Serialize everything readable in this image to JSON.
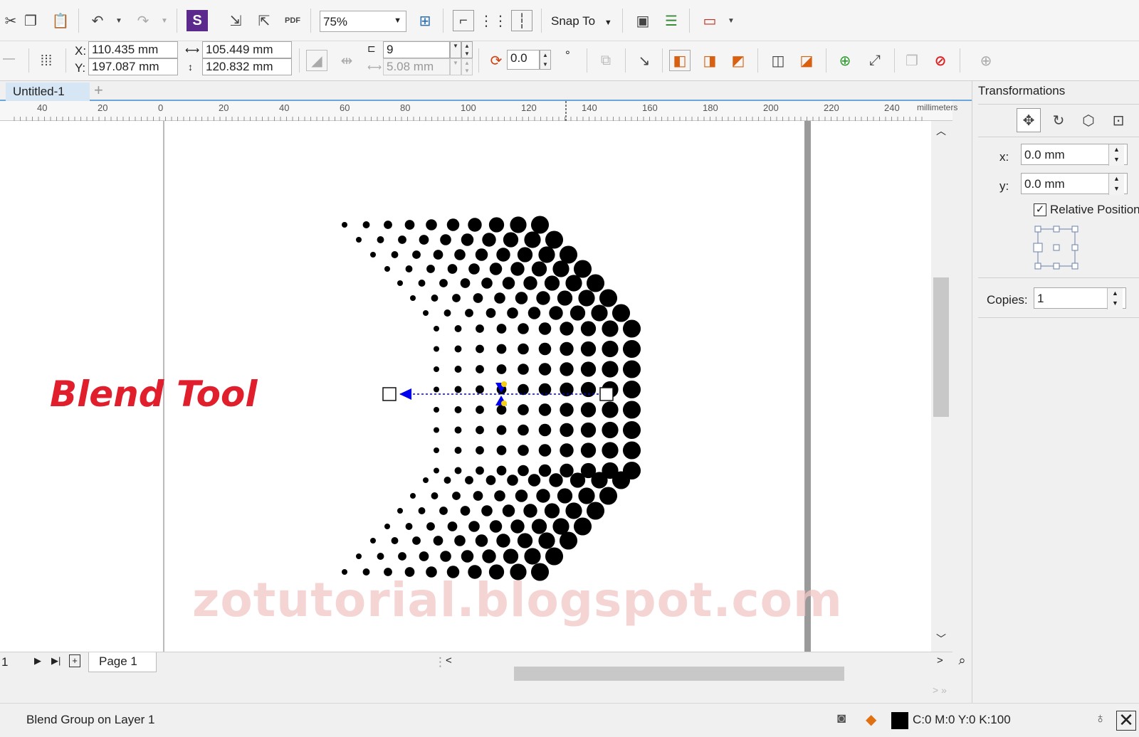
{
  "toolbar": {
    "zoom_value": "75%",
    "snap_label": "Snap To"
  },
  "property_bar": {
    "x_label": "X:",
    "x_value": "110.435 mm",
    "y_label": "Y:",
    "y_value": "197.087 mm",
    "width_value": "105.449 mm",
    "height_value": "120.832 mm",
    "steps_value": "9",
    "offset_value": "5.08 mm",
    "angle_value": "0.0",
    "angle_unit": "°"
  },
  "tabs": {
    "document_tab": "Untitled-1",
    "add_tab": "+"
  },
  "ruler": {
    "labels": [
      "40",
      "20",
      "0",
      "20",
      "40",
      "60",
      "80",
      "100",
      "120",
      "140",
      "160",
      "180",
      "200",
      "220",
      "240"
    ],
    "unit": "millimeters"
  },
  "docker": {
    "title": "Transformations",
    "x_label": "x:",
    "x_value": "0.0 mm",
    "y_label": "y:",
    "y_value": "0.0 mm",
    "relative_label": "Relative Position",
    "relative_checked": true,
    "copies_label": "Copies:",
    "copies_value": "1"
  },
  "page_nav": {
    "page_count": "1",
    "page_tab": "Page 1"
  },
  "status": {
    "object_info": "Blend Group on Layer 1",
    "fill_info": "C:0 M:0 Y:0 K:100"
  },
  "overlay": {
    "title": "Blend Tool",
    "watermark": "zotutorial.blogspot.com"
  },
  "colors": {
    "accent_red": "#e01e2c",
    "blend_blue": "#0000ee",
    "dot_black": "#000000",
    "watermark_pink": "#f2c6c6"
  }
}
